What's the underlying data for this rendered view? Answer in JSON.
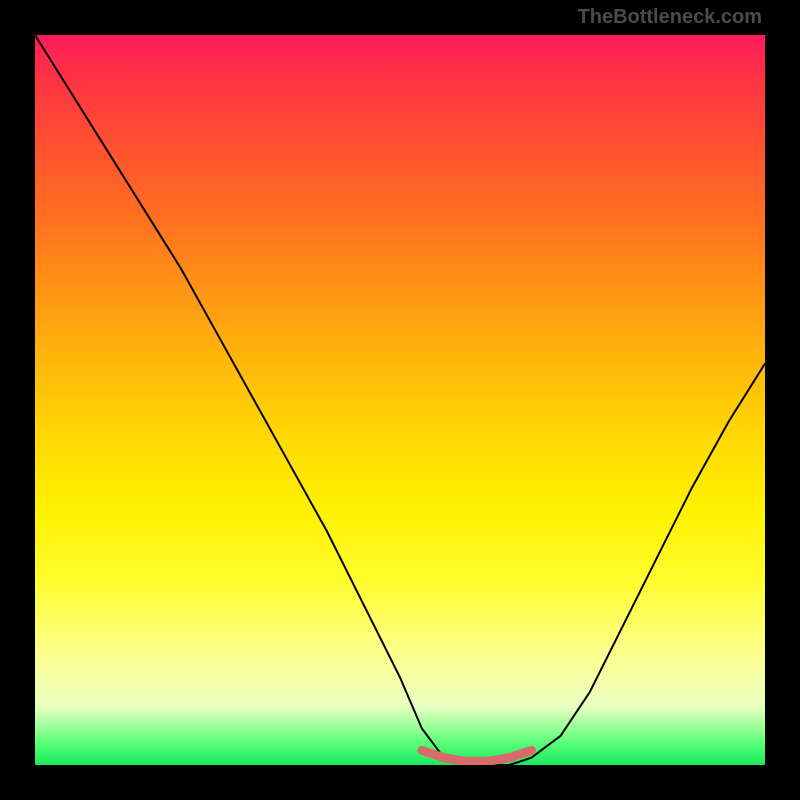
{
  "watermark": "TheBottleneck.com",
  "chart_data": {
    "type": "line",
    "title": "",
    "xlabel": "",
    "ylabel": "",
    "xlim": [
      0,
      100
    ],
    "ylim": [
      0,
      100
    ],
    "series": [
      {
        "name": "bottleneck-curve",
        "x": [
          0,
          5,
          10,
          15,
          20,
          25,
          30,
          35,
          40,
          45,
          50,
          53,
          56,
          59,
          62,
          65,
          68,
          72,
          76,
          80,
          85,
          90,
          95,
          100
        ],
        "values": [
          100,
          92,
          84,
          76,
          68,
          59,
          50,
          41,
          32,
          22,
          12,
          5,
          1,
          0,
          0,
          0,
          1,
          4,
          10,
          18,
          28,
          38,
          47,
          55
        ]
      },
      {
        "name": "bottom-marker",
        "x": [
          53,
          56,
          59,
          62,
          65,
          68
        ],
        "values": [
          2,
          1,
          0.5,
          0.5,
          1,
          2
        ]
      }
    ],
    "colors": {
      "curve": "#000000",
      "marker": "#d86a6a",
      "gradient_top": "#ff1a5a",
      "gradient_bottom": "#18e860"
    }
  }
}
